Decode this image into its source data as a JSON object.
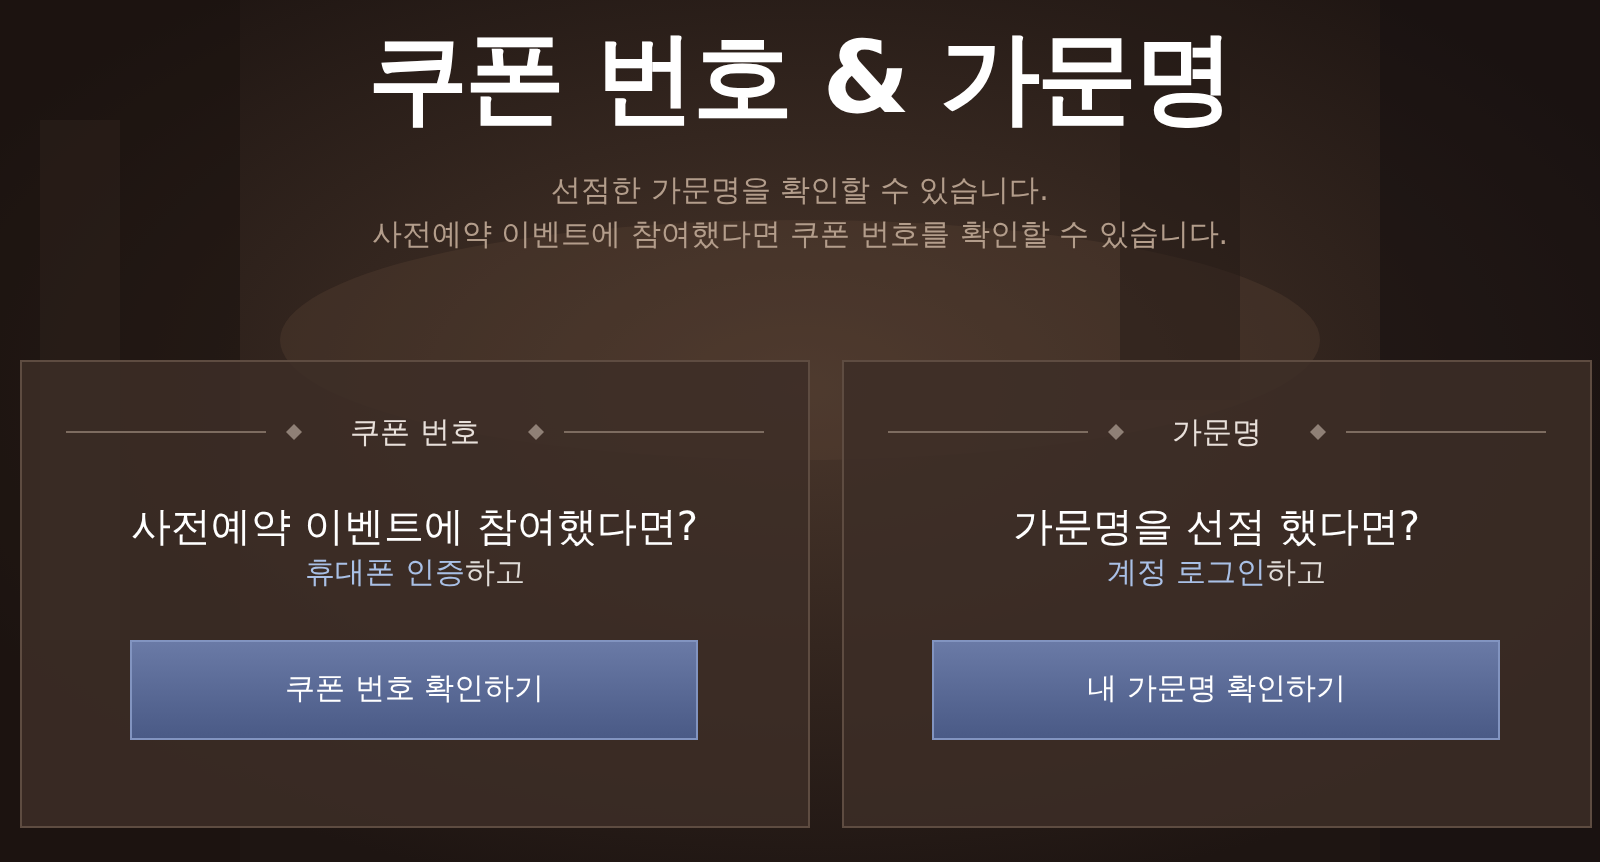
{
  "title": "쿠폰 번호 & 가문명",
  "subtitle_lines": [
    "선점한 가문명을 확인할 수 있습니다.",
    "사전예약 이벤트에 참여했다면 쿠폰 번호를 확인할 수 있습니다."
  ],
  "cards": [
    {
      "heading": "쿠폰 번호",
      "question": "사전예약 이벤트에 참여했다면?",
      "hint_highlight": "휴대폰 인증",
      "hint_rest": "하고",
      "button": "쿠폰 번호 확인하기"
    },
    {
      "heading": "가문명",
      "question": "가문명을 선점 했다면?",
      "hint_highlight": "계정 로그인",
      "hint_rest": "하고",
      "button": "내 가문명 확인하기"
    }
  ]
}
